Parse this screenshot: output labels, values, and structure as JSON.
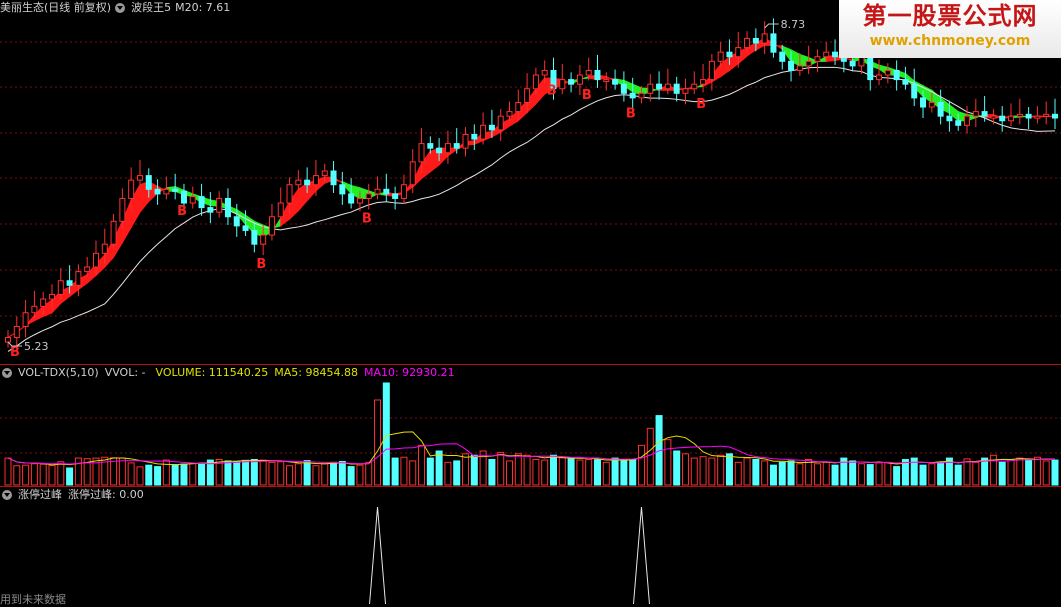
{
  "main": {
    "stock_name": "美丽生态(日线 前复权)",
    "indicator_name": "波段王5",
    "ma_label": "M20: 7.61",
    "high_label": "8.73",
    "low_label": "5.23",
    "buy_marker": "B"
  },
  "volume": {
    "indicator": "VOL-TDX(5,10)",
    "vvol": "VVOL: -",
    "volume_label": "VOLUME: 111540.25",
    "ma5_label": "MA5: 98454.88",
    "ma10_label": "MA10: 92930.21"
  },
  "limit": {
    "indicator": "涨停过峰",
    "value_label": "涨停过峰: 0.00"
  },
  "footer": {
    "text": "用到未来数据"
  },
  "watermark": {
    "title": "第一股票公式网",
    "url": "www.chnmoney.com"
  },
  "colors": {
    "up": "#ff3030",
    "down": "#54ffff",
    "band_up": "#ff1a1a",
    "band_down": "#22ee22",
    "ma": "#e6e6e6",
    "ma5": "#e0e000",
    "ma10": "#ff00ff",
    "grid": "#7a1010"
  },
  "chart_data": {
    "type": "candlestick",
    "price_range": [
      5.23,
      8.73
    ],
    "closes": [
      5.28,
      5.4,
      5.55,
      5.62,
      5.7,
      5.75,
      5.9,
      5.85,
      6.0,
      6.05,
      6.2,
      6.3,
      6.55,
      6.8,
      7.0,
      7.05,
      6.9,
      6.85,
      6.9,
      6.88,
      6.75,
      6.82,
      6.7,
      6.65,
      6.8,
      6.6,
      6.5,
      6.45,
      6.3,
      6.4,
      6.6,
      6.75,
      6.95,
      7.0,
      6.95,
      7.05,
      7.1,
      6.95,
      6.85,
      6.75,
      6.8,
      6.85,
      6.9,
      6.85,
      6.8,
      6.95,
      7.2,
      7.4,
      7.35,
      7.3,
      7.4,
      7.35,
      7.5,
      7.45,
      7.6,
      7.55,
      7.7,
      7.75,
      7.85,
      8.0,
      8.15,
      8.2,
      8.0,
      8.1,
      8.05,
      8.15,
      8.2,
      8.1,
      8.1,
      8.05,
      7.95,
      7.9,
      7.95,
      8.05,
      8.0,
      8.05,
      7.95,
      8.0,
      8.05,
      8.1,
      8.3,
      8.4,
      8.35,
      8.45,
      8.55,
      8.5,
      8.6,
      8.4,
      8.3,
      8.2,
      8.25,
      8.3,
      8.35,
      8.4,
      8.35,
      8.3,
      8.25,
      8.4,
      8.1,
      8.15,
      8.2,
      8.1,
      8.05,
      7.9,
      7.8,
      7.85,
      7.7,
      7.65,
      7.6,
      7.7,
      7.75,
      7.7,
      7.7,
      7.65,
      7.7,
      7.72,
      7.68,
      7.7,
      7.72,
      7.68
    ],
    "buy_points": [
      0,
      19,
      28,
      40,
      61,
      65,
      70,
      78
    ],
    "volumes": [
      9.5,
      6.8,
      7.0,
      7.5,
      7.3,
      6.9,
      8.2,
      6.0,
      9.5,
      9.3,
      9.5,
      9.8,
      9.6,
      9.5,
      7.8,
      6.4,
      7.0,
      6.5,
      8.8,
      7.2,
      7.4,
      7.6,
      7.7,
      8.8,
      9.0,
      8.5,
      8.2,
      8.7,
      9.0,
      8.8,
      8.0,
      8.2,
      6.8,
      7.5,
      8.6,
      6.8,
      7.5,
      8.0,
      8.3,
      6.5,
      7.0,
      8.0,
      30.0,
      36.0,
      9.5,
      9.8,
      8.5,
      14.0,
      9.5,
      12.0,
      8.0,
      8.5,
      11.0,
      10.5,
      12.0,
      9.0,
      11.5,
      8.5,
      11.0,
      10.5,
      9.0,
      8.8,
      10.5,
      9.6,
      9.5,
      8.8,
      9.0,
      8.9,
      8.0,
      9.5,
      8.8,
      9.0,
      14.0,
      20.0,
      24.5,
      16.0,
      12.0,
      11.0,
      9.5,
      10.0,
      9.5,
      10.5,
      11.0,
      8.0,
      9.5,
      9.0,
      8.5,
      7.0,
      8.0,
      8.5,
      7.5,
      9.0,
      7.5,
      8.0,
      7.0,
      9.5,
      8.5,
      7.5,
      7.2,
      7.8,
      8.0,
      6.5,
      9.0,
      9.5,
      7.0,
      7.5,
      8.0,
      9.5,
      7.0,
      9.2,
      8.0,
      9.5,
      10.5,
      8.0,
      9.0,
      9.5,
      9.0,
      9.8,
      8.5,
      8.8
    ],
    "limit_up_points": [
      42,
      72
    ],
    "ylabel": ""
  }
}
